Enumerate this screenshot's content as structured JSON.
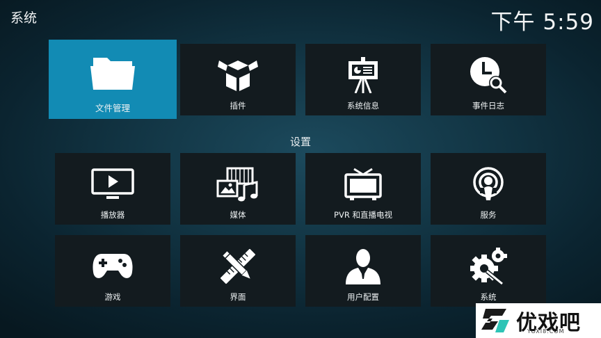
{
  "header": {
    "title": "系统",
    "clock": "下午 5:59"
  },
  "top_row": [
    {
      "label": "文件管理",
      "icon": "folder-icon",
      "focused": true
    },
    {
      "label": "插件",
      "icon": "open-box-icon"
    },
    {
      "label": "系统信息",
      "icon": "presentation-board-icon"
    },
    {
      "label": "事件日志",
      "icon": "clock-search-icon"
    }
  ],
  "settings": {
    "heading": "设置",
    "items": [
      {
        "label": "播放器",
        "icon": "tv-play-icon"
      },
      {
        "label": "媒体",
        "icon": "media-icon"
      },
      {
        "label": "PVR 和直播电视",
        "icon": "television-icon"
      },
      {
        "label": "服务",
        "icon": "podcast-icon"
      },
      {
        "label": "游戏",
        "icon": "gamepad-icon"
      },
      {
        "label": "界面",
        "icon": "pencil-ruler-icon"
      },
      {
        "label": "用户配置",
        "icon": "user-profile-icon"
      },
      {
        "label": "系统",
        "icon": "gears-icon"
      }
    ]
  },
  "watermark": {
    "brand": "优戏吧",
    "url": "YOXI8.COM"
  },
  "colors": {
    "focus": "#128bb4",
    "tile": "#131b1f",
    "background": "#0f2f3d"
  }
}
